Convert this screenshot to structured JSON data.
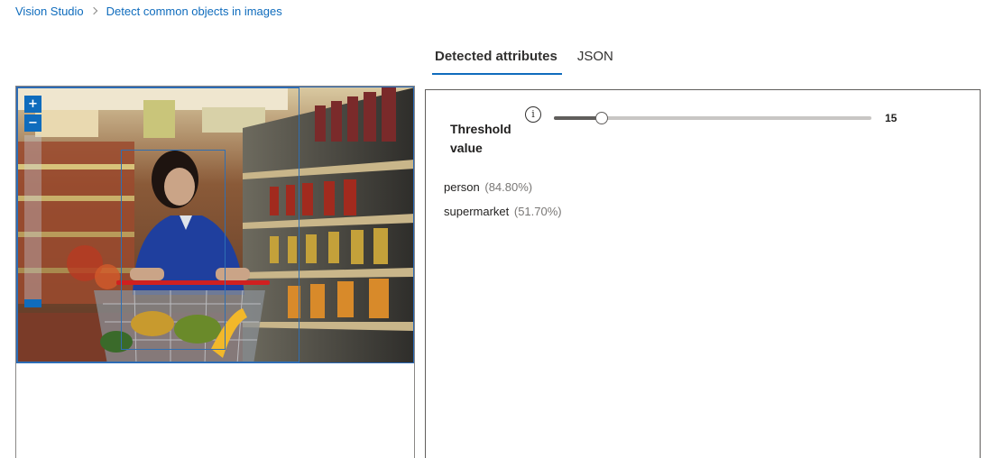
{
  "breadcrumb": {
    "items": [
      "Vision Studio",
      "Detect common objects in images"
    ]
  },
  "tabs": [
    {
      "label": "Detected attributes",
      "active": true
    },
    {
      "label": "JSON",
      "active": false
    }
  ],
  "viewer": {
    "zoom_in_label": "+",
    "zoom_out_label": "−",
    "image": "photo of a woman in a blue sweater pushing a shopping cart with produce down a supermarket aisle",
    "bounding_box_count": 2
  },
  "threshold": {
    "label": "Threshold value",
    "info_icon": "info-icon",
    "value": 15,
    "min": 0,
    "max": 100,
    "value_text": "15"
  },
  "results": [
    {
      "name": "person",
      "confidence": "(84.80%)"
    },
    {
      "name": "supermarket",
      "confidence": "(51.70%)"
    }
  ],
  "colors": {
    "accent": "#0f6cbd",
    "box": "#2f6fb3",
    "muted": "#797775"
  }
}
